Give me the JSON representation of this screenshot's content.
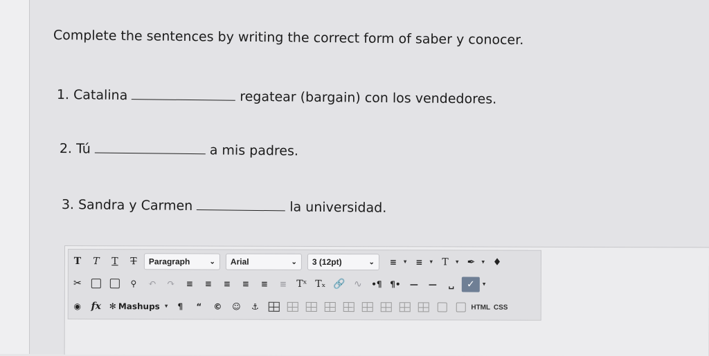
{
  "instructions": "Complete the sentences by writing the correct form of saber y conocer.",
  "questions": [
    {
      "prefix": "1. Catalina",
      "suffix": "regatear (bargain) con los vendedores."
    },
    {
      "prefix": "2. Tú",
      "suffix": "a mis padres."
    },
    {
      "prefix": "3. Sandra y Carmen",
      "suffix": "la universidad."
    }
  ],
  "toolbar": {
    "format_buttons": [
      "T",
      "T",
      "T",
      "T"
    ],
    "paragraph_select": "Paragraph",
    "font_select": "Arial",
    "size_select": "3 (12pt)",
    "mashups_label": "Mashups",
    "html_label": "HTML",
    "css_label": "CSS",
    "fx_label": "fx",
    "superscript_label": "Tˣ",
    "subscript_label": "Tₓ",
    "spell_label": "ABC"
  }
}
